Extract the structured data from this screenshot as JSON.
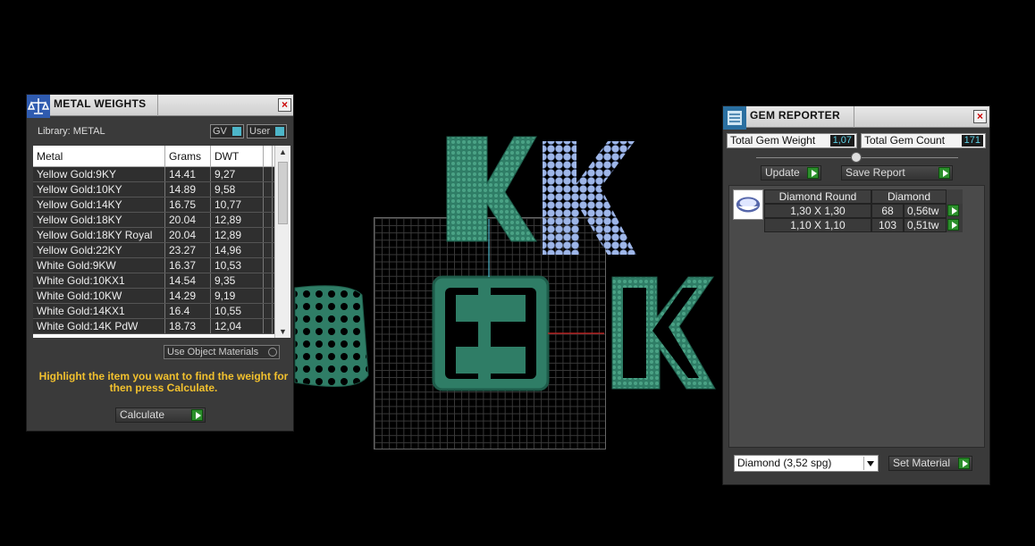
{
  "metal_weights": {
    "title": "METAL WEIGHTS",
    "library_label": "Library: METAL",
    "toggle_gv": "GV",
    "toggle_user": "User",
    "columns": [
      "Metal",
      "Grams",
      "DWT"
    ],
    "rows": [
      {
        "metal": "Yellow Gold:9KY",
        "grams": "14.41",
        "dwt": "9,27"
      },
      {
        "metal": "Yellow Gold:10KY",
        "grams": "14.89",
        "dwt": "9,58"
      },
      {
        "metal": "Yellow Gold:14KY",
        "grams": "16.75",
        "dwt": "10,77"
      },
      {
        "metal": "Yellow Gold:18KY",
        "grams": "20.04",
        "dwt": "12,89"
      },
      {
        "metal": "Yellow Gold:18KY Royal",
        "grams": "20.04",
        "dwt": "12,89"
      },
      {
        "metal": "Yellow Gold:22KY",
        "grams": "23.27",
        "dwt": "14,96"
      },
      {
        "metal": "White Gold:9KW",
        "grams": "16.37",
        "dwt": "10,53"
      },
      {
        "metal": "White Gold:10KX1",
        "grams": "14.54",
        "dwt": "9,35"
      },
      {
        "metal": "White Gold:10KW",
        "grams": "14.29",
        "dwt": "9,19"
      },
      {
        "metal": "White Gold:14KX1",
        "grams": "16.4",
        "dwt": "10,55"
      },
      {
        "metal": "White Gold:14K PdW",
        "grams": "18.73",
        "dwt": "12,04"
      }
    ],
    "use_object_materials": "Use Object Materials",
    "hint": "Highlight the item you want to find the weight for then press Calculate.",
    "calculate_label": "Calculate"
  },
  "gem_reporter": {
    "title": "GEM REPORTER",
    "total_weight_label": "Total Gem Weight",
    "total_weight_value": "1,07",
    "total_count_label": "Total Gem Count",
    "total_count_value": "171",
    "update_label": "Update",
    "save_report_label": "Save Report",
    "table_header": {
      "shape": "Diamond Round",
      "material": "Diamond"
    },
    "rows": [
      {
        "size": "1,30 X 1,30",
        "count": "68",
        "weight": "0,56tw"
      },
      {
        "size": "1,10 X 1,10",
        "count": "103",
        "weight": "0,51tw"
      }
    ],
    "material_select": "Diamond     (3,52 spg)",
    "set_material_label": "Set Material"
  },
  "colors": {
    "model_green": "#2f7d66",
    "gem_blue": "#9eb6e8",
    "hint_yellow": "#f2c12e",
    "value_cyan": "#5cd1e6"
  }
}
